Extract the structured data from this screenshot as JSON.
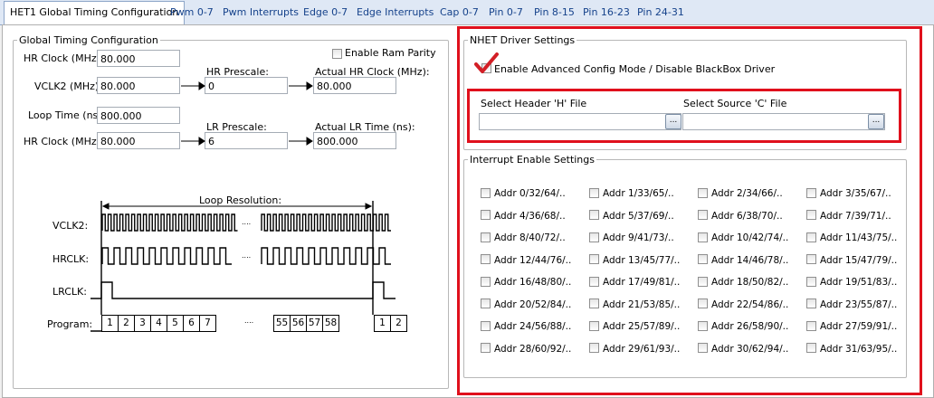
{
  "tabs": [
    {
      "label": "HET1 Global Timing Configuration",
      "active": true
    },
    {
      "label": "Pwm 0-7"
    },
    {
      "label": "Pwm Interrupts"
    },
    {
      "label": "Edge 0-7"
    },
    {
      "label": "Edge Interrupts"
    },
    {
      "label": "Cap 0-7"
    },
    {
      "label": "Pin 0-7"
    },
    {
      "label": "Pin 8-15"
    },
    {
      "label": "Pin 16-23"
    },
    {
      "label": "Pin 24-31"
    }
  ],
  "global": {
    "legend": "Global Timing Configuration",
    "enable_ram_parity": "Enable Ram Parity",
    "hr_clock_label": "HR Clock (MHz):",
    "hr_clock_value": "80.000",
    "vclk2_label": "VCLK2 (MHz):",
    "vclk2_value": "80.000",
    "hr_prescale_label": "HR Prescale:",
    "hr_prescale_value": "0",
    "actual_hr_label": "Actual HR Clock (MHz):",
    "actual_hr_value": "80.000",
    "loop_time_label": "Loop Time (ns):",
    "loop_time_value": "800.000",
    "hr_clock2_label": "HR Clock (MHz):",
    "hr_clock2_value": "80.000",
    "lr_prescale_label": "LR Prescale:",
    "lr_prescale_value": "6",
    "actual_lr_label": "Actual LR Time (ns):",
    "actual_lr_value": "800.000"
  },
  "diagram": {
    "loop_resolution": "Loop Resolution:",
    "vclk2": "VCLK2:",
    "hrclk": "HRCLK:",
    "lrclk": "LRCLK:",
    "program": "Program:",
    "dots": "....",
    "slots_a": [
      "1",
      "2",
      "3",
      "4",
      "5",
      "6",
      "7"
    ],
    "slots_b": [
      "55",
      "56",
      "57",
      "58"
    ],
    "slots_c": [
      "1",
      "2"
    ]
  },
  "nhet": {
    "legend": "NHET Driver Settings",
    "advanced": "Enable Advanced Config Mode / Disable BlackBox Driver",
    "header_label": "Select Header 'H' File",
    "source_label": "Select Source 'C' File",
    "browse": "...",
    "header_value": "",
    "source_value": ""
  },
  "interrupts": {
    "legend": "Interrupt Enable Settings",
    "items": [
      "Addr 0/32/64/..",
      "Addr 1/33/65/..",
      "Addr 2/34/66/..",
      "Addr 3/35/67/..",
      "Addr 4/36/68/..",
      "Addr 5/37/69/..",
      "Addr 6/38/70/..",
      "Addr 7/39/71/..",
      "Addr 8/40/72/..",
      "Addr 9/41/73/..",
      "Addr 10/42/74/..",
      "Addr 11/43/75/..",
      "Addr 12/44/76/..",
      "Addr 13/45/77/..",
      "Addr 14/46/78/..",
      "Addr 15/47/79/..",
      "Addr 16/48/80/..",
      "Addr 17/49/81/..",
      "Addr 18/50/82/..",
      "Addr 19/51/83/..",
      "Addr 20/52/84/..",
      "Addr 21/53/85/..",
      "Addr 22/54/86/..",
      "Addr 23/55/87/..",
      "Addr 24/56/88/..",
      "Addr 25/57/89/..",
      "Addr 26/58/90/..",
      "Addr 27/59/91/..",
      "Addr 28/60/92/..",
      "Addr 29/61/93/..",
      "Addr 30/62/94/..",
      "Addr 31/63/95/.."
    ]
  },
  "colors": {
    "highlight": "#e0101c",
    "tab_text": "#15428b"
  }
}
